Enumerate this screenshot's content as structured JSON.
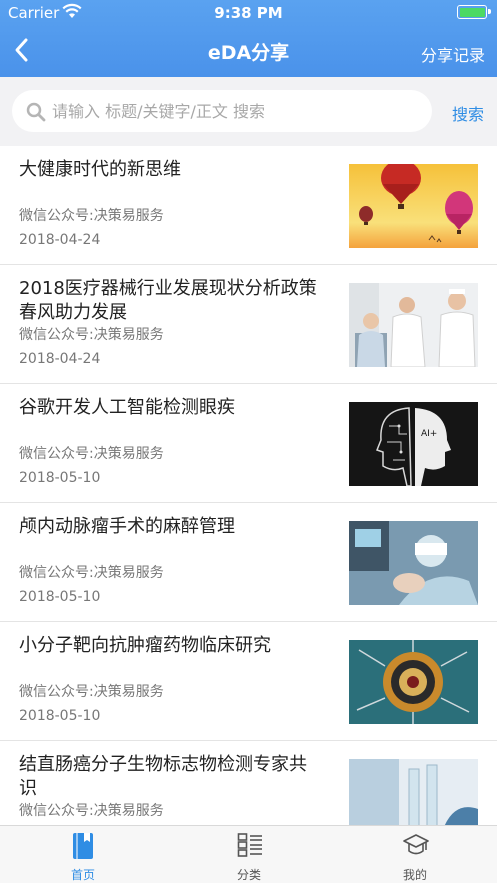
{
  "status": {
    "carrier": "Carrier",
    "time": "9:38 PM"
  },
  "nav": {
    "title": "eDA分享",
    "record": "分享记录"
  },
  "search": {
    "placeholder": "请输入 标题/关键字/正文 搜索",
    "button": "搜索"
  },
  "articles": [
    {
      "title": "大健康时代的新思维",
      "source": "微信公众号:决策易服务",
      "date": "2018-04-24",
      "image": "hot-air-balloons"
    },
    {
      "title": "2018医疗器械行业发展现状分析政策春风助力发展",
      "source": "微信公众号:决策易服务",
      "date": "2018-04-24",
      "image": "nurses-and-patient"
    },
    {
      "title": "谷歌开发人工智能检测眼疾",
      "source": "微信公众号:决策易服务",
      "date": "2018-05-10",
      "image": "ai-head",
      "image_text": "AI+"
    },
    {
      "title": "颅内动脉瘤手术的麻醉管理",
      "source": "微信公众号:决策易服务",
      "date": "2018-05-10",
      "image": "surgery"
    },
    {
      "title": "小分子靶向抗肿瘤药物临床研究",
      "source": "微信公众号:决策易服务",
      "date": "2018-05-10",
      "image": "cell-target"
    },
    {
      "title": "结直肠癌分子生物标志物检测专家共识",
      "source": "微信公众号:决策易服务",
      "date": "",
      "image": "lab-test"
    }
  ],
  "tabs": [
    {
      "label": "首页",
      "icon": "book-icon",
      "active": true
    },
    {
      "label": "分类",
      "icon": "category-list-icon",
      "active": false
    },
    {
      "label": "我的",
      "icon": "graduation-cap-icon",
      "active": false
    }
  ],
  "colors": {
    "header": "#4a92ea",
    "accent": "#2f8de4",
    "battery": "#4cd964"
  }
}
